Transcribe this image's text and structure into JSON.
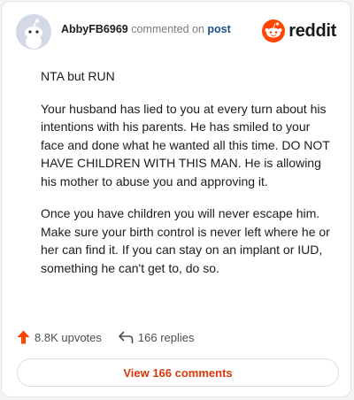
{
  "header": {
    "username": "AbbyFB6969",
    "action_text": "commented on",
    "post_link": "post",
    "brand": "reddit"
  },
  "icons": {
    "avatar": "snoo-avatar-icon",
    "logo": "reddit-logo-icon",
    "upvote": "upvote-arrow-icon",
    "reply": "reply-arrow-icon"
  },
  "comment": {
    "paragraphs": [
      "NTA but RUN",
      "Your husband has lied to you at every turn about his intentions with his parents. He has smiled to your face and done what he wanted all this time. DO NOT HAVE CHILDREN WITH THIS MAN. He is allowing his mother to abuse you and approving it.",
      "Once you have children you will never escape him. Make sure your birth control is never left where he or her can find it. If you can stay on an implant or IUD, something he can't get to, do so."
    ]
  },
  "stats": {
    "upvotes": "8.8K upvotes",
    "replies": "166 replies"
  },
  "footer": {
    "view_button": "View 166 comments"
  },
  "colors": {
    "brand_orange": "#ff4500",
    "link_blue": "#1c4f86",
    "button_text": "#d9380a"
  }
}
